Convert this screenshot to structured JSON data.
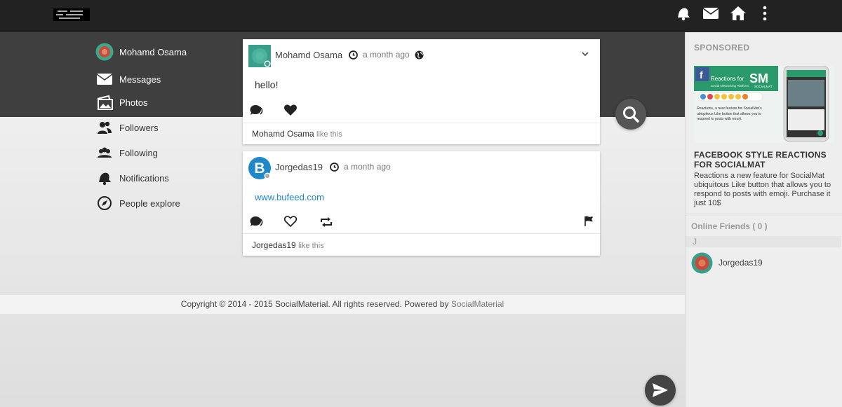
{
  "menu": {
    "items": [
      {
        "label": "Mohamd Osama"
      },
      {
        "label": "Messages"
      },
      {
        "label": "Photos"
      },
      {
        "label": "Followers"
      },
      {
        "label": "Following"
      },
      {
        "label": "Notifications"
      },
      {
        "label": "People explore"
      }
    ]
  },
  "posts": [
    {
      "author": "Mohamd Osama",
      "time": "a month ago",
      "body": "hello!",
      "liked_by": "Mohamd Osama",
      "like_suffix": "like this"
    },
    {
      "author": "Jorgedas19",
      "avatar_letter": "B",
      "time": "a month ago",
      "link": "www.bufeed.com",
      "liked_by": "Jorgedas19",
      "like_suffix": "like this"
    }
  ],
  "footer": {
    "text": "Copyright © 2014 - 2015 SocialMaterial. All rights reserved. Powered by",
    "link": "SocialMaterial"
  },
  "sidebar": {
    "sponsored_title": "SPONSORED",
    "ad": {
      "image_text_1": "Reactions for",
      "image_text_2": "Social Networking Platform",
      "image_brand": "SOCIALMAT",
      "image_caption": "Reactions, a new feature for SocialMat's ubiquitous Like button that allows you to respond to posts with emoji.",
      "title": "FACEBOOK STYLE REACTIONS FOR SOCIALMAT",
      "description": "Reactions a new feature for SocialMat ubiquitous Like button that allows you to respond to posts with emoji. Purchase it just 10$"
    },
    "online_title": "Online Friends ( 0 )",
    "letter": "J",
    "friend": "Jorgedas19"
  },
  "colors": {
    "topbar": "#222222",
    "banner": "#3f3f3f",
    "link": "#1e88c8",
    "avatar_blue": "#1e88c8"
  }
}
